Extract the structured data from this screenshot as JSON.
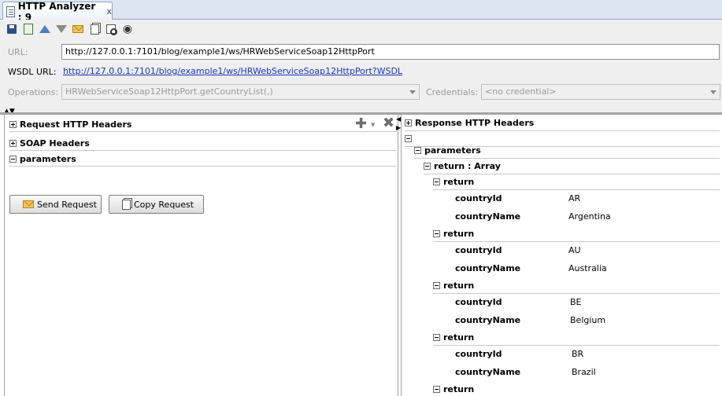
{
  "tab": {
    "title": "HTTP Analyzer : 9",
    "close": "x"
  },
  "toolbar": {
    "icons": [
      "save-icon",
      "import-icon",
      "up-icon",
      "down-icon",
      "envelope-icon",
      "copy-icon",
      "find-icon",
      "binoculars-icon"
    ]
  },
  "form": {
    "url_label": "URL:",
    "url_value": "http://127.0.0.1:7101/blog/example1/ws/HRWebServiceSoap12HttpPort",
    "wsdl_label": "WSDL URL:",
    "wsdl_value": "http://127.0.0.1:7101/blog/example1/ws/HRWebServiceSoap12HttpPort?WSDL",
    "operations_label": "Operations:",
    "operations_value": "HRWebServiceSoap12HttpPort.getCountryList(,)",
    "credentials_label": "Credentials:",
    "credentials_value": "<no credential>"
  },
  "request": {
    "sections": [
      "Request HTTP Headers",
      "SOAP Headers",
      "parameters"
    ],
    "send_button": "Send Request",
    "copy_button": "Copy Request"
  },
  "response": {
    "header_section": "Response HTTP Headers",
    "parameters": "parameters",
    "return_array": "return : Array",
    "return_label": "return",
    "id_field": "countryId",
    "name_field": "countryName",
    "countries": [
      {
        "id": "AR",
        "name": "Argentina"
      },
      {
        "id": "AU",
        "name": "Australia"
      },
      {
        "id": "BE",
        "name": "Belgium"
      },
      {
        "id": "BR",
        "name": "Brazil"
      }
    ]
  }
}
